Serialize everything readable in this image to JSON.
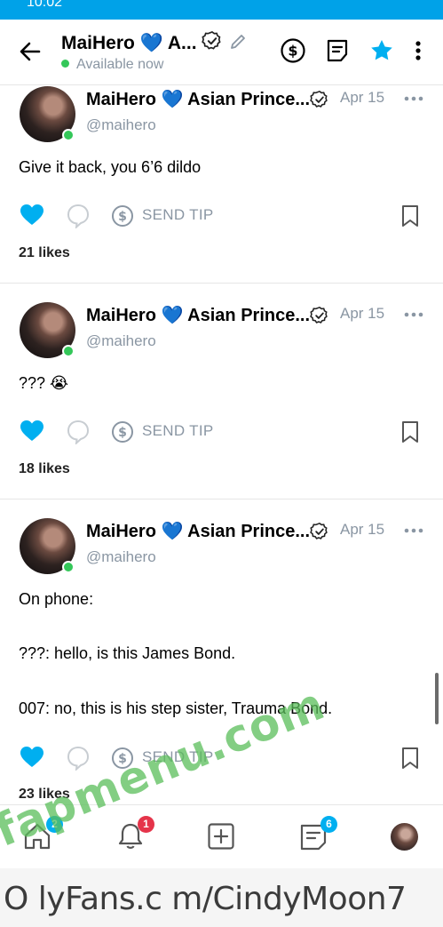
{
  "status_bar": {
    "time": "10:02"
  },
  "header": {
    "name": "MaiHero 💙 A...",
    "status": "Available now",
    "colors": {
      "accent": "#00aff0",
      "online": "#34c759"
    }
  },
  "posts": [
    {
      "author": "MaiHero 💙 Asian Prince...",
      "date": "Apr 15",
      "handle": "@maihero",
      "lines": [
        "Give it back, you 6’6 dildo"
      ],
      "tip_label": "SEND TIP",
      "likes": "21 likes"
    },
    {
      "author": "MaiHero 💙 Asian Prince...",
      "date": "Apr 15",
      "handle": "@maihero",
      "lines": [
        "??? 😭"
      ],
      "tip_label": "SEND TIP",
      "likes": "18 likes"
    },
    {
      "author": "MaiHero 💙 Asian Prince...",
      "date": "Apr 15",
      "handle": "@maihero",
      "lines": [
        "On phone:",
        "???: hello, is this James Bond.",
        "007: no, this is his step sister, Trauma Bond."
      ],
      "tip_label": "SEND TIP",
      "likes": "23 likes"
    }
  ],
  "bottom_nav": {
    "home_badge": "2",
    "notifications_badge": "1",
    "messages_badge": "6"
  },
  "watermark": "fapmenu.com",
  "url_overlay": "O lyFans.c m/CindyMoon7"
}
